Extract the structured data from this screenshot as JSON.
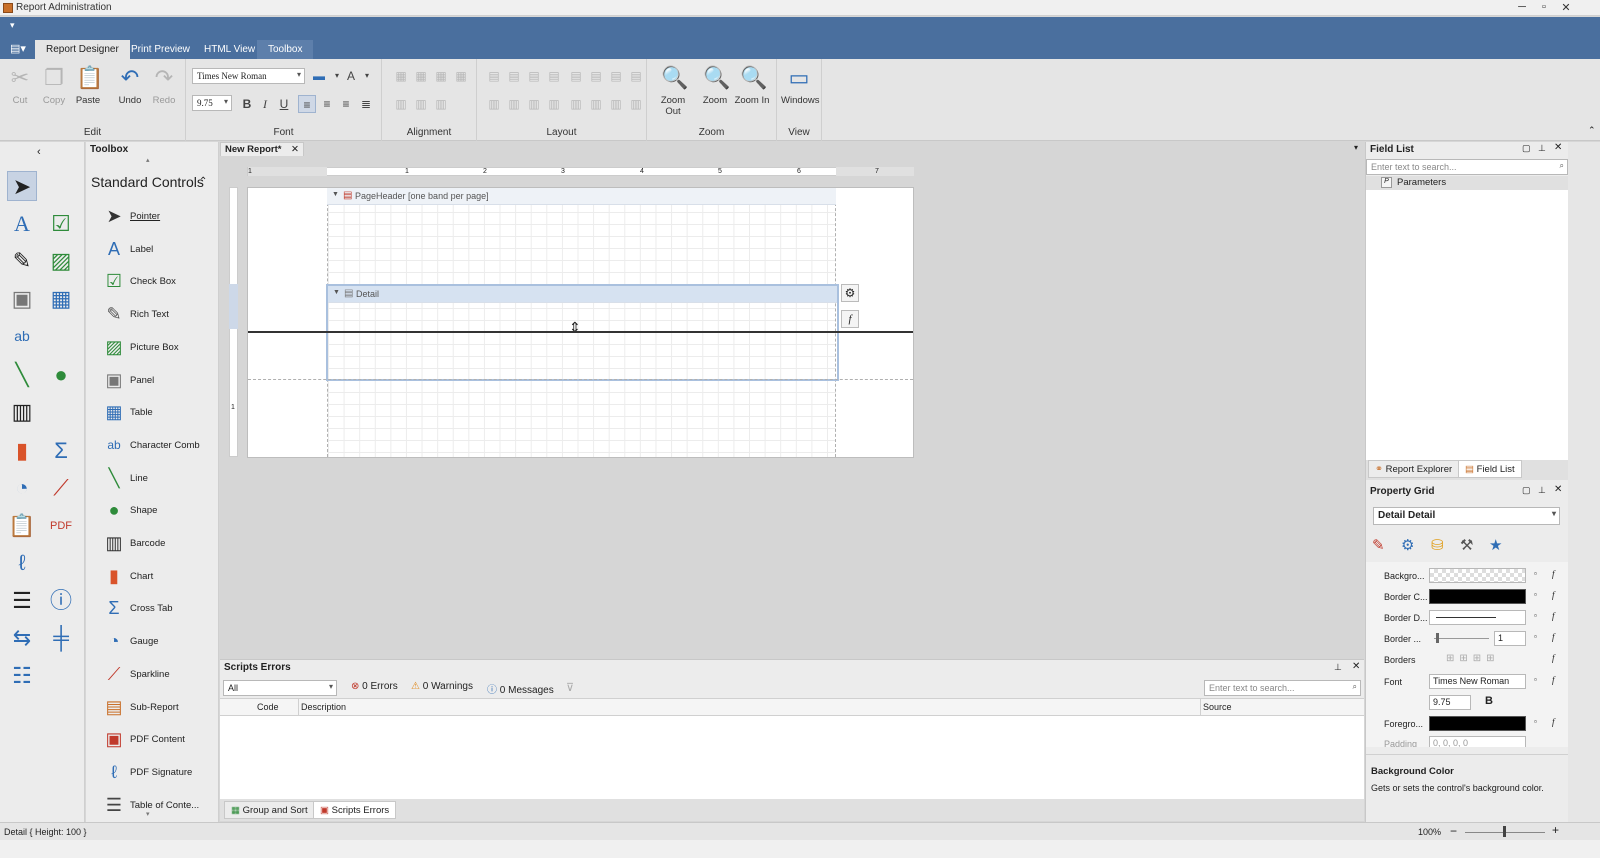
{
  "window": {
    "title": "Report Administration"
  },
  "ribbon": {
    "tabs": [
      "Report Designer",
      "Print Preview",
      "HTML View",
      "Toolbox"
    ],
    "edit": {
      "label": "Edit",
      "cut": "Cut",
      "copy": "Copy",
      "paste": "Paste",
      "undo": "Undo",
      "redo": "Redo"
    },
    "font": {
      "label": "Font",
      "family": "Times New Roman",
      "size": "9.75"
    },
    "alignment": {
      "label": "Alignment"
    },
    "layout": {
      "label": "Layout"
    },
    "zoom": {
      "label": "Zoom",
      "zoom_out": "Zoom Out",
      "zoom": "Zoom",
      "zoom_in": "Zoom In"
    },
    "view": {
      "label": "View",
      "windows": "Windows"
    }
  },
  "toolbox": {
    "title": "Toolbox",
    "category": "Standard Controls",
    "items": [
      "Pointer",
      "Label",
      "Check Box",
      "Rich Text",
      "Picture Box",
      "Panel",
      "Table",
      "Character Comb",
      "Line",
      "Shape",
      "Barcode",
      "Chart",
      "Cross Tab",
      "Gauge",
      "Sparkline",
      "Sub-Report",
      "PDF Content",
      "PDF Signature",
      "Table of Conte..."
    ]
  },
  "document": {
    "tab": "New Report*",
    "ruler_labels": [
      "1",
      "1",
      "2",
      "3",
      "4",
      "5",
      "6",
      "7"
    ],
    "vruler_label": "1",
    "bands": {
      "page_header": "PageHeader [one band per page]",
      "detail": "Detail"
    }
  },
  "scripts_errors": {
    "title": "Scripts Errors",
    "filter": "All",
    "errors": "0 Errors",
    "warnings": "0 Warnings",
    "messages": "0 Messages",
    "search_placeholder": "Enter text to search...",
    "columns": [
      "Code",
      "Description",
      "Source"
    ]
  },
  "bottom_tabs": [
    "Group and Sort",
    "Scripts Errors"
  ],
  "field_list": {
    "title": "Field List",
    "search_placeholder": "Enter text to search...",
    "items": [
      "Parameters"
    ],
    "tabs": [
      "Report Explorer",
      "Field List"
    ]
  },
  "property_grid": {
    "title": "Property Grid",
    "selected": "Detail  Detail",
    "rows": {
      "background": "Backgro...",
      "border_color": "Border C...",
      "border_dash": "Border D...",
      "border_width": "Border ...",
      "borders": "Borders",
      "font": "Font",
      "foreground": "Foregro...",
      "padding": "Padding"
    },
    "border_width_value": "1",
    "font_family": "Times New Roman",
    "font_size": "9.75",
    "padding_value": "0, 0, 0, 0",
    "description_title": "Background Color",
    "description": "Gets or sets the control's background color."
  },
  "status": {
    "left": "Detail { Height: 100 }",
    "zoom": "100%"
  },
  "colors": {
    "ribbon_header": "#4a6f9e",
    "accent": "#2f6db5"
  }
}
